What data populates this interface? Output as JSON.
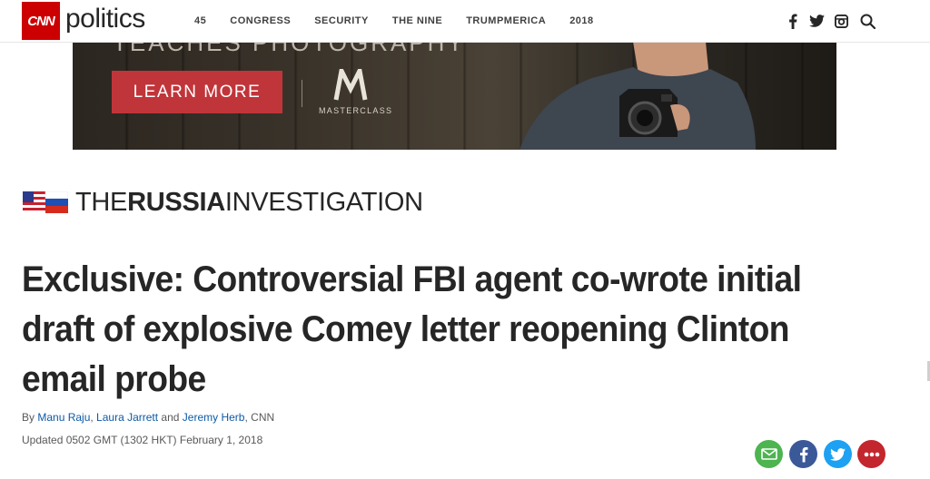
{
  "header": {
    "logo_text": "CNN",
    "section": "politics",
    "nav": [
      {
        "label": "45"
      },
      {
        "label": "CONGRESS"
      },
      {
        "label": "SECURITY"
      },
      {
        "label": "THE NINE"
      },
      {
        "label": "TRUMPMERICA"
      },
      {
        "label": "2018"
      }
    ],
    "icons": [
      "facebook-icon",
      "twitter-icon",
      "instagram-icon",
      "search-icon"
    ]
  },
  "ad": {
    "top_text": "TEACHES PHOTOGRAPHY",
    "cta": "LEARN MORE",
    "brand_letter": "M",
    "brand": "MASTERCLASS"
  },
  "kicker": {
    "part1": "THE",
    "part2": "RUSSIA",
    "part3": "INVESTIGATION"
  },
  "article": {
    "headline": "Exclusive: Controversial FBI agent co-wrote initial draft of explosive Comey letter reopening Clinton email probe",
    "by_prefix": "By ",
    "authors": [
      "Manu Raju",
      "Laura Jarrett",
      "Jeremy Herb"
    ],
    "sep1": ", ",
    "sep2": " and ",
    "outlet_suffix": ", CNN",
    "updated": "Updated 0502 GMT (1302 HKT) February 1, 2018"
  },
  "share_icons": [
    "email-share-icon",
    "facebook-share-icon",
    "twitter-share-icon",
    "more-share-icon"
  ],
  "colors": {
    "cnn_red": "#cc0000",
    "link_blue": "#0c5aa6",
    "cta_red": "#c0353a",
    "email_green": "#4db450",
    "facebook_blue": "#3b5998",
    "twitter_blue": "#1da1f2",
    "more_red": "#c4262e"
  }
}
